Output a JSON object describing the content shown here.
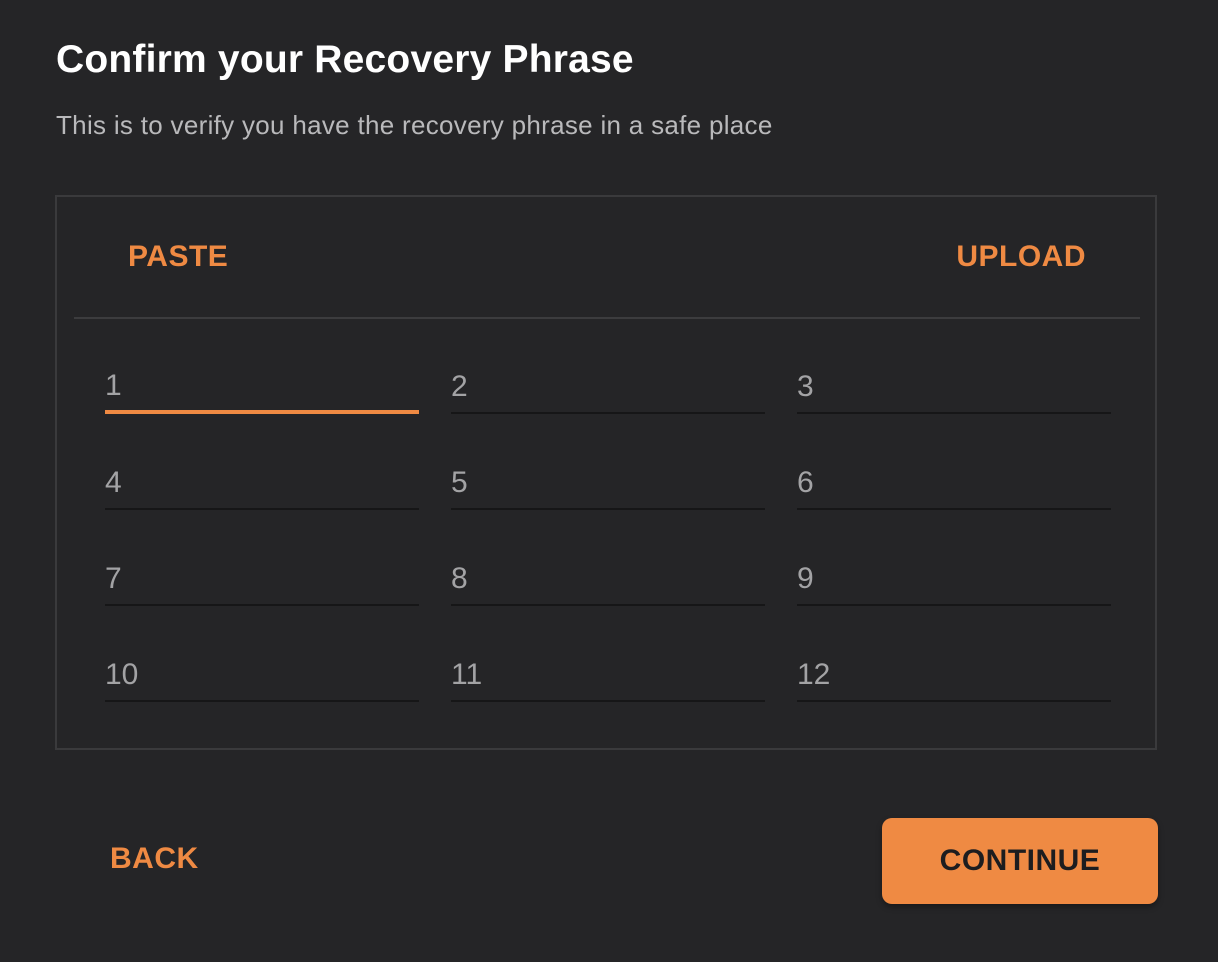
{
  "header": {
    "title": "Confirm your Recovery Phrase",
    "subtitle": "This is to verify you have the recovery phrase in a safe place"
  },
  "panel": {
    "paste_label": "PASTE",
    "upload_label": "UPLOAD",
    "words": [
      {
        "placeholder": "1",
        "value": ""
      },
      {
        "placeholder": "2",
        "value": ""
      },
      {
        "placeholder": "3",
        "value": ""
      },
      {
        "placeholder": "4",
        "value": ""
      },
      {
        "placeholder": "5",
        "value": ""
      },
      {
        "placeholder": "6",
        "value": ""
      },
      {
        "placeholder": "7",
        "value": ""
      },
      {
        "placeholder": "8",
        "value": ""
      },
      {
        "placeholder": "9",
        "value": ""
      },
      {
        "placeholder": "10",
        "value": ""
      },
      {
        "placeholder": "11",
        "value": ""
      },
      {
        "placeholder": "12",
        "value": ""
      }
    ],
    "focused_word_index": 0
  },
  "footer": {
    "back_label": "BACK",
    "continue_label": "CONTINUE"
  },
  "colors": {
    "accent": "#ef8a43",
    "background": "#252527",
    "title_text": "#ffffff",
    "muted_text": "#b9b9bb"
  }
}
